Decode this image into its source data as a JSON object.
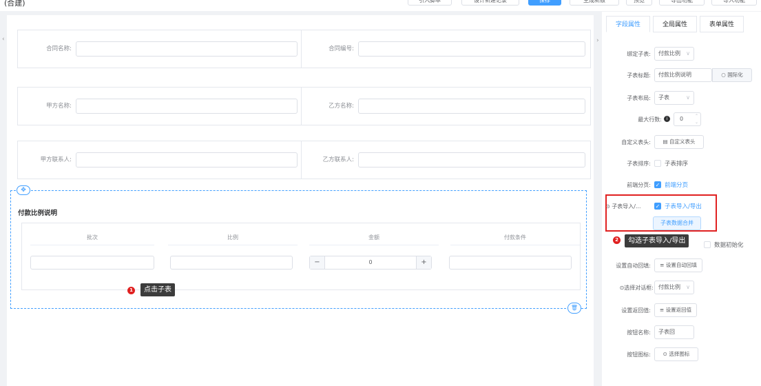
{
  "topbar": {
    "title": "(合建)",
    "buttons": [
      "引入脚本",
      "设计新建记录",
      "保存",
      "生成新版",
      "预览",
      "导出功能",
      "导入功能"
    ]
  },
  "form": {
    "rows": [
      [
        {
          "label": "合同名称:",
          "value": ""
        },
        {
          "label": "合同编号:",
          "value": ""
        }
      ],
      [
        {
          "label": "甲方名称:",
          "value": ""
        },
        {
          "label": "乙方名称:",
          "value": ""
        }
      ],
      [
        {
          "label": "甲方联系人:",
          "value": ""
        },
        {
          "label": "乙方联系人:",
          "value": ""
        }
      ]
    ]
  },
  "subtable": {
    "title": "付款比例说明",
    "columns": [
      "批次",
      "比例",
      "金额",
      "付款条件"
    ],
    "stepper_value": "0"
  },
  "callouts": {
    "c1_num": "1",
    "c1_text": "点击子表",
    "c2_num": "2",
    "c2_text": "勾选子表导入/导出"
  },
  "panel": {
    "tabs": [
      "字段属性",
      "全局属性",
      "表单属性"
    ],
    "bind_subtable_label": "绑定子表:",
    "bind_subtable_value": "付款比例",
    "subtable_title_label": "子表标题:",
    "subtable_title_value": "付款比例说明",
    "i18n_button": "国际化",
    "layout_label": "子表布局:",
    "layout_value": "子表",
    "max_rows_label": "最大行数:",
    "max_rows_value": "0",
    "custom_header_label": "自定义表头:",
    "custom_header_button": "自定义表头",
    "sort_label": "子表排序:",
    "sort_text": "子表排序",
    "paging_label": "前端分页:",
    "paging_text": "前端分页",
    "import_label": "子表导入/...",
    "import_text": "子表导入/导出",
    "merge_button": "子表数据合并",
    "data_init_text": "数据初始化",
    "auto_fill_label": "设置自动回填:",
    "auto_fill_button": "设置自动回填",
    "select_dialog_label": "选择对话框:",
    "select_dialog_value": "付款比例",
    "return_value_label": "设置返回值:",
    "return_value_button": "设置返回值",
    "button_name_label": "按钮名称:",
    "button_name_value": "子表回",
    "button_icon_label": "按钮图标:",
    "button_icon_button": "选择图标"
  }
}
